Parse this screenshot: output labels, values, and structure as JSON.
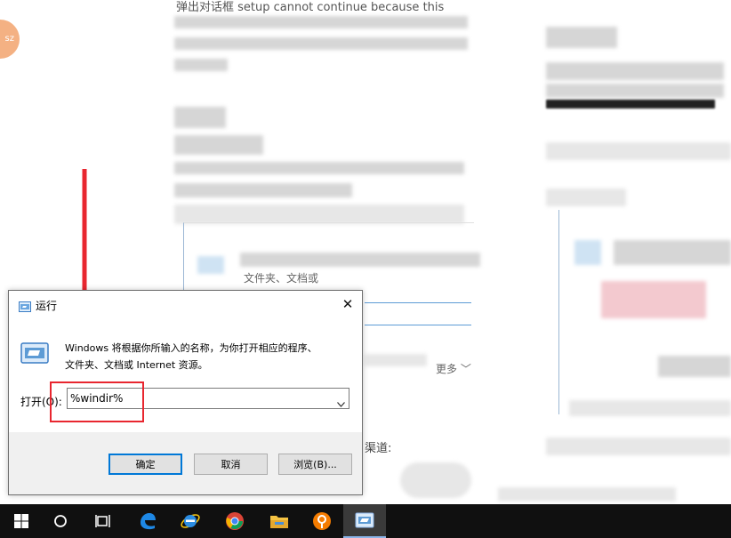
{
  "background": {
    "top_text": "弹出对话框 setup cannot continue because this",
    "fragment_text": "文件夹、文档或",
    "more_link": "更多",
    "channel_text": "渠道:"
  },
  "run_dialog": {
    "title": "运行",
    "close_symbol": "✕",
    "description_line1": "Windows 将根据你所输入的名称，为你打开相应的程序、",
    "description_line2": "文件夹、文档或 Internet 资源。",
    "open_label": "打开(O):",
    "open_value": "%windir%",
    "buttons": {
      "ok": "确定",
      "cancel": "取消",
      "browse": "浏览(B)..."
    }
  },
  "taskbar": {
    "items": [
      "start-icon",
      "search-icon",
      "task-view-icon",
      "edge-icon",
      "internet-explorer-icon",
      "chrome-icon",
      "file-explorer-icon",
      "app-icon",
      "run-icon"
    ]
  },
  "colors": {
    "highlight": "#e8262f",
    "arrow": "#e8262f",
    "accent": "#0078d7",
    "taskbar": "#101010"
  }
}
